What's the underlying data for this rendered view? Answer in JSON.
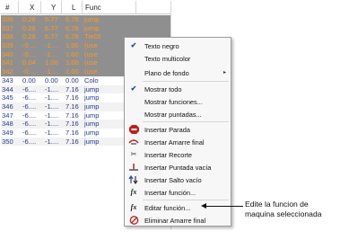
{
  "table": {
    "headers": [
      "#",
      "X",
      "Y",
      "L",
      "Func"
    ],
    "rows": [
      {
        "num": "336",
        "x": "0.28",
        "y": "6.77",
        "l": "6.78",
        "func": "jump",
        "style": "orange"
      },
      {
        "num": "337",
        "x": "0.28",
        "y": "6.77",
        "l": "6.78",
        "func": "jump",
        "style": "orange"
      },
      {
        "num": "338",
        "x": "0.28",
        "y": "6.77",
        "l": "6.78",
        "func": "TieOf",
        "style": "orange"
      },
      {
        "num": "339",
        "x": "-0....",
        "y": "-1....",
        "l": "1.00",
        "func": "(use",
        "style": "orange"
      },
      {
        "num": "340",
        "x": "-0....",
        "y": "-1....",
        "l": "1.00",
        "func": "(use",
        "style": "orange"
      },
      {
        "num": "341",
        "x": "0.04",
        "y": "1.00",
        "l": "1.00",
        "func": "(use",
        "style": "orange"
      },
      {
        "num": "342",
        "x": "-0....",
        "y": "-1....",
        "l": "1.00",
        "func": "(use",
        "style": "orange"
      },
      {
        "num": "343",
        "x": "0.00",
        "y": "0.00",
        "l": "0.00",
        "func": "Colo",
        "style": "blue"
      },
      {
        "num": "344",
        "x": "-6....",
        "y": "-1....",
        "l": "7.16",
        "func": "jump",
        "style": "blue-alt"
      },
      {
        "num": "345",
        "x": "-6....",
        "y": "-1....",
        "l": "7.16",
        "func": "jump",
        "style": "blue"
      },
      {
        "num": "346",
        "x": "-6....",
        "y": "-1....",
        "l": "7.16",
        "func": "jump",
        "style": "blue-alt"
      },
      {
        "num": "347",
        "x": "-6....",
        "y": "-1....",
        "l": "7.16",
        "func": "jump",
        "style": "blue"
      },
      {
        "num": "348",
        "x": "-6....",
        "y": "-1....",
        "l": "7.16",
        "func": "jump",
        "style": "blue-alt"
      },
      {
        "num": "349",
        "x": "-6....",
        "y": "-1....",
        "l": "7.16",
        "func": "jump",
        "style": "blue"
      },
      {
        "num": "350",
        "x": "-6....",
        "y": "-1....",
        "l": "7.16",
        "func": "jump",
        "style": "blue-alt"
      }
    ]
  },
  "menu": {
    "texto_negro": "Texto negro",
    "texto_multicolor": "Texto multicolor",
    "plano_de_fondo": "Plano de fondo",
    "mostrar_todo": "Mostrar todo",
    "mostrar_funciones": "Mostrar funciones...",
    "mostrar_puntadas": "Mostrar puntadas...",
    "insertar_parada": "Insertar Parada",
    "insertar_amarre_final": "Insertar Amarre final",
    "insertar_recorte": "Insertar Recorte",
    "insertar_puntada_vacia": "Insertar Puntada vacía",
    "insertar_salto_vacio": "Insertar Salto vacío",
    "insertar_funcion": "Insertar función...",
    "editar_funcion": "Editar función...",
    "eliminar_amarre_final": "Eliminar Amarre final",
    "submenu_arrow": "▸"
  },
  "callout": {
    "line1": "Edite la funcion de",
    "line2": "maquina seleccionada"
  },
  "colors": {
    "selected_row_text": "#ff9a1e",
    "selected_row_bg": "#8f8f8f",
    "row_text": "#2b3a8f",
    "check_mark": "#1f4fa8",
    "stop_icon": "#c0201d"
  },
  "icons": {
    "check": "checkmark-icon",
    "stop": "stop-icon",
    "tie_off": "tie-off-icon",
    "trim": "scissors-icon",
    "empty_stitch": "empty-stitch-icon",
    "empty_jump": "empty-jump-icon",
    "function": "function-icon",
    "edit_function": "edit-function-icon",
    "delete_tie": "delete-tie-icon"
  }
}
